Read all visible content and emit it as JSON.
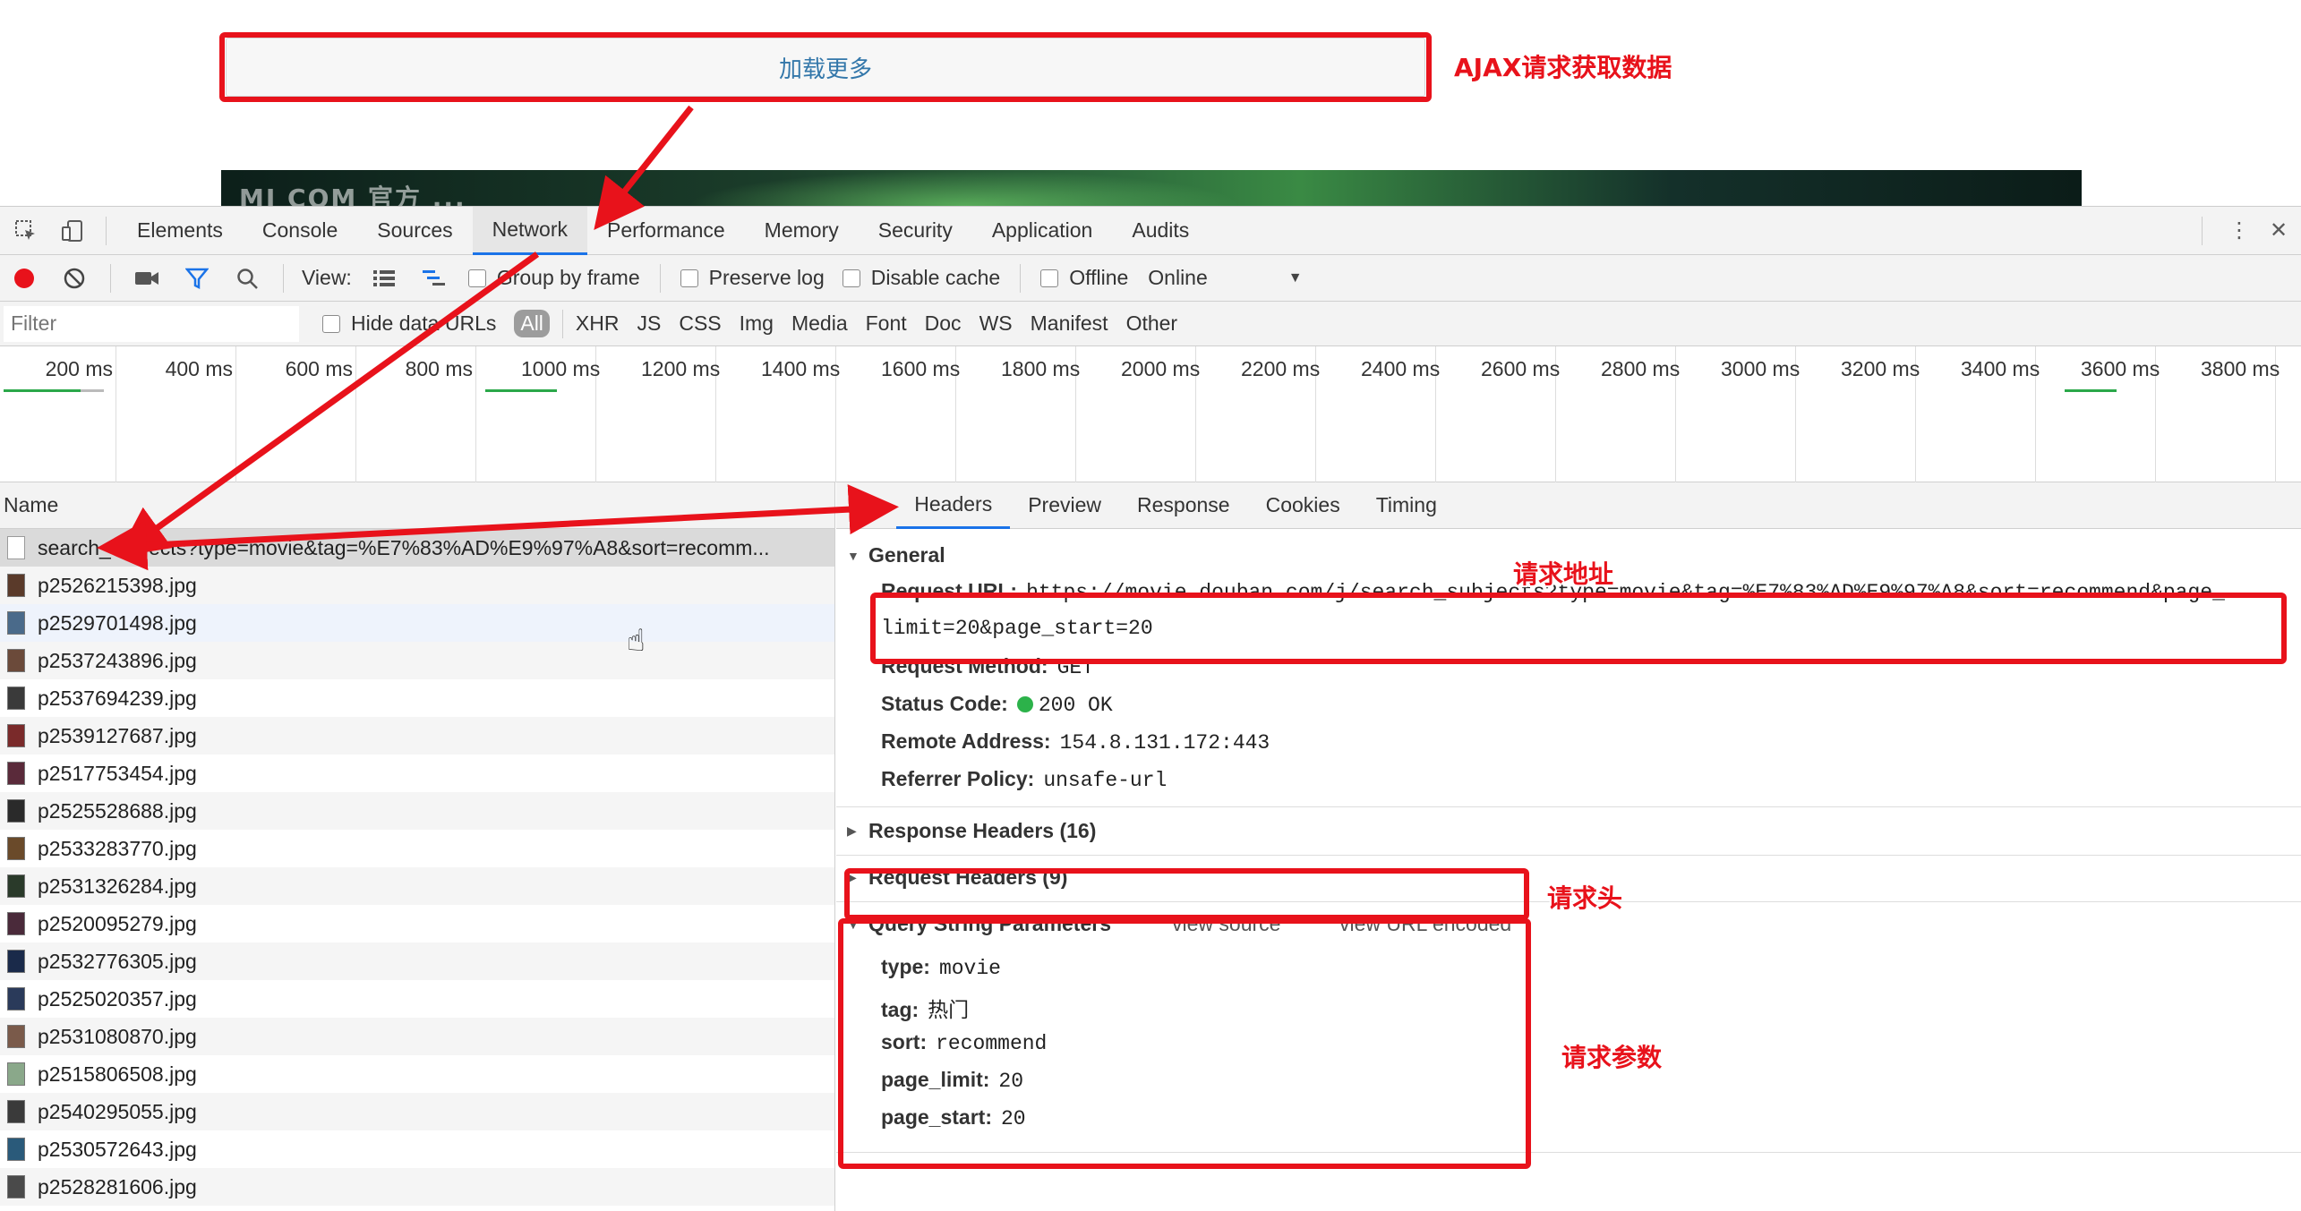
{
  "page": {
    "load_more_label": "加载更多",
    "banner_ghost_text": "MI COM 官方 ..."
  },
  "annotations": {
    "ajax": "AJAX请求获取数据",
    "request_url": "请求地址",
    "request_headers": "请求头",
    "query_params": "请求参数"
  },
  "devtools": {
    "tabs": [
      "Elements",
      "Console",
      "Sources",
      "Network",
      "Performance",
      "Memory",
      "Security",
      "Application",
      "Audits"
    ],
    "active_tab": "Network",
    "toolbar": {
      "view_label": "View:",
      "group_by_frame": "Group by frame",
      "preserve_log": "Preserve log",
      "disable_cache": "Disable cache",
      "offline": "Offline",
      "throttle": "Online"
    },
    "filter": {
      "placeholder": "Filter",
      "hide_data_urls": "Hide data URLs",
      "types": [
        "All",
        "XHR",
        "JS",
        "CSS",
        "Img",
        "Media",
        "Font",
        "Doc",
        "WS",
        "Manifest",
        "Other"
      ]
    },
    "timeline_ticks": [
      "200 ms",
      "400 ms",
      "600 ms",
      "800 ms",
      "1000 ms",
      "1200 ms",
      "1400 ms",
      "1600 ms",
      "1800 ms",
      "2000 ms",
      "2200 ms",
      "2400 ms",
      "2600 ms",
      "2800 ms",
      "3000 ms",
      "3200 ms",
      "3400 ms",
      "3600 ms",
      "3800 ms"
    ],
    "list": {
      "header": "Name",
      "rows": [
        "search_subjects?type=movie&tag=%E7%83%AD%E9%97%A8&sort=recomm...",
        "p2526215398.jpg",
        "p2529701498.jpg",
        "p2537243896.jpg",
        "p2537694239.jpg",
        "p2539127687.jpg",
        "p2517753454.jpg",
        "p2525528688.jpg",
        "p2533283770.jpg",
        "p2531326284.jpg",
        "p2520095279.jpg",
        "p2532776305.jpg",
        "p2525020357.jpg",
        "p2531080870.jpg",
        "p2515806508.jpg",
        "p2540295055.jpg",
        "p2530572643.jpg",
        "p2528281606.jpg"
      ],
      "thumb_colors": [
        "#5a3a2a",
        "#4a6a8a",
        "#6b4a3a",
        "#3a3a3a",
        "#7a2a2a",
        "#5a2a3a",
        "#2a2a2a",
        "#6a4a2a",
        "#2a3a2a",
        "#4a2a3a",
        "#1a2a4a",
        "#2a3a5a",
        "#7a5a4a",
        "#8aa88a",
        "#3a3a3a",
        "#2a5a7a",
        "#4a4a4a"
      ]
    },
    "detail": {
      "tabs": [
        "Headers",
        "Preview",
        "Response",
        "Cookies",
        "Timing"
      ],
      "active_tab": "Headers",
      "general_title": "General",
      "request_url_key": "Request URL:",
      "request_url_line1": "https://movie.douban.com/j/search_subjects?type=movie&tag=%E7%83%AD%E9%97%A8&sort=recommend&page_",
      "request_url_line2": "limit=20&page_start=20",
      "request_method_key": "Request Method:",
      "request_method": "GET",
      "status_code_key": "Status Code:",
      "status_code": "200 OK",
      "remote_address_key": "Remote Address:",
      "remote_address": "154.8.131.172:443",
      "referrer_policy_key": "Referrer Policy:",
      "referrer_policy": "unsafe-url",
      "response_headers_title": "Response Headers (16)",
      "request_headers_title": "Request Headers (9)",
      "query_title": "Query String Parameters",
      "view_source": "view source",
      "view_url_encoded": "view URL encoded",
      "params": [
        {
          "key": "type:",
          "value": "movie"
        },
        {
          "key": "tag:",
          "value": "热门"
        },
        {
          "key": "sort:",
          "value": "recommend"
        },
        {
          "key": "page_limit:",
          "value": "20"
        },
        {
          "key": "page_start:",
          "value": "20"
        }
      ]
    }
  },
  "colors": {
    "annotation_red": "#e8121b",
    "status_green": "#2cb24a",
    "accent_blue": "#1a73e8"
  }
}
